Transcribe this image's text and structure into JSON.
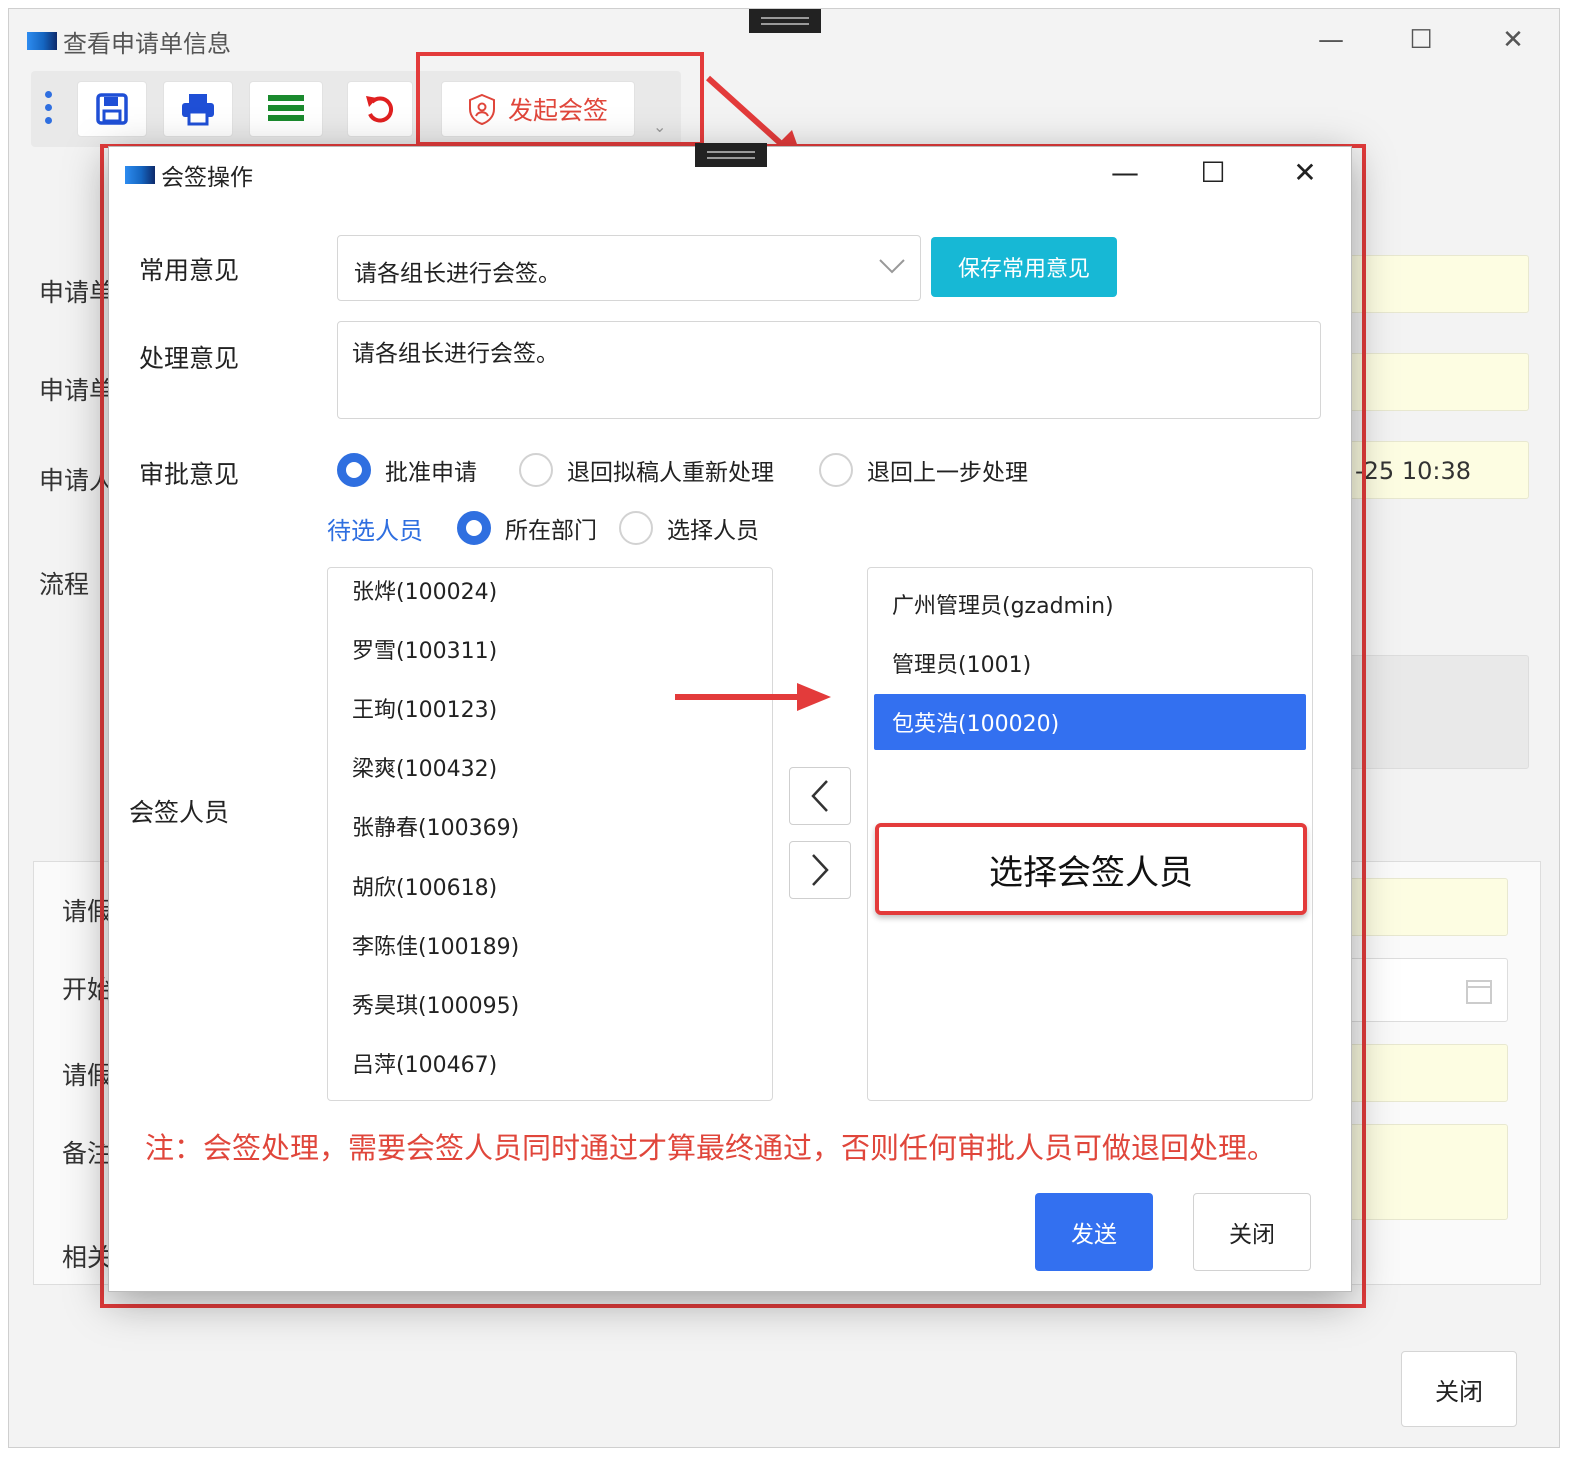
{
  "outer_window": {
    "title": "查看申请单信息",
    "controls": {
      "minimize": "—",
      "maximize": "☐",
      "close": "✕"
    },
    "toolbar": {
      "countersign_label": "发起会签"
    },
    "labels": [
      "申请单",
      "申请单",
      "申请人",
      "流程",
      "请假",
      "开始",
      "请假",
      "备注",
      "相关"
    ],
    "date_value": "-25 10:38",
    "close_label": "关闭"
  },
  "dialog": {
    "title": "会签操作",
    "controls": {
      "minimize": "—",
      "maximize": "☐",
      "close": "✕"
    },
    "common_opinion": {
      "label": "常用意见",
      "value": "请各组长进行会签。",
      "save_label": "保存常用意见"
    },
    "handle_opinion": {
      "label": "处理意见",
      "value": "请各组长进行会签。"
    },
    "approval": {
      "label": "审批意见",
      "options": [
        "批准申请",
        "退回拟稿人重新处理",
        "退回上一步处理"
      ],
      "selected": "批准申请"
    },
    "candidates": {
      "label": "待选人员",
      "options": [
        "所在部门",
        "选择人员"
      ],
      "selected": "所在部门",
      "items": [
        "张烨(100024)",
        "罗雪(100311)",
        "王珣(100123)",
        "梁爽(100432)",
        "张静春(100369)",
        "胡欣(100618)",
        "李陈佳(100189)",
        "秀昊琪(100095)",
        "吕萍(100467)"
      ]
    },
    "signers": {
      "label": "会签人员",
      "items": [
        "广州管理员(gzadmin)",
        "管理员(1001)",
        "包英浩(100020)"
      ],
      "selected": "包英浩(100020)"
    },
    "move_left": "<",
    "move_right": ">",
    "callout": "选择会签人员",
    "note": "注：会签处理，需要会签人员同时通过才算最终通过，否则任何审批人员可做退回处理。",
    "send_label": "发送",
    "close_label": "关闭"
  },
  "colors": {
    "accent": "#3370f0",
    "teal": "#17b8d5",
    "annotation_red": "#e33b3b",
    "note_red": "#e0463b",
    "field_yellow": "#fdfde2"
  }
}
